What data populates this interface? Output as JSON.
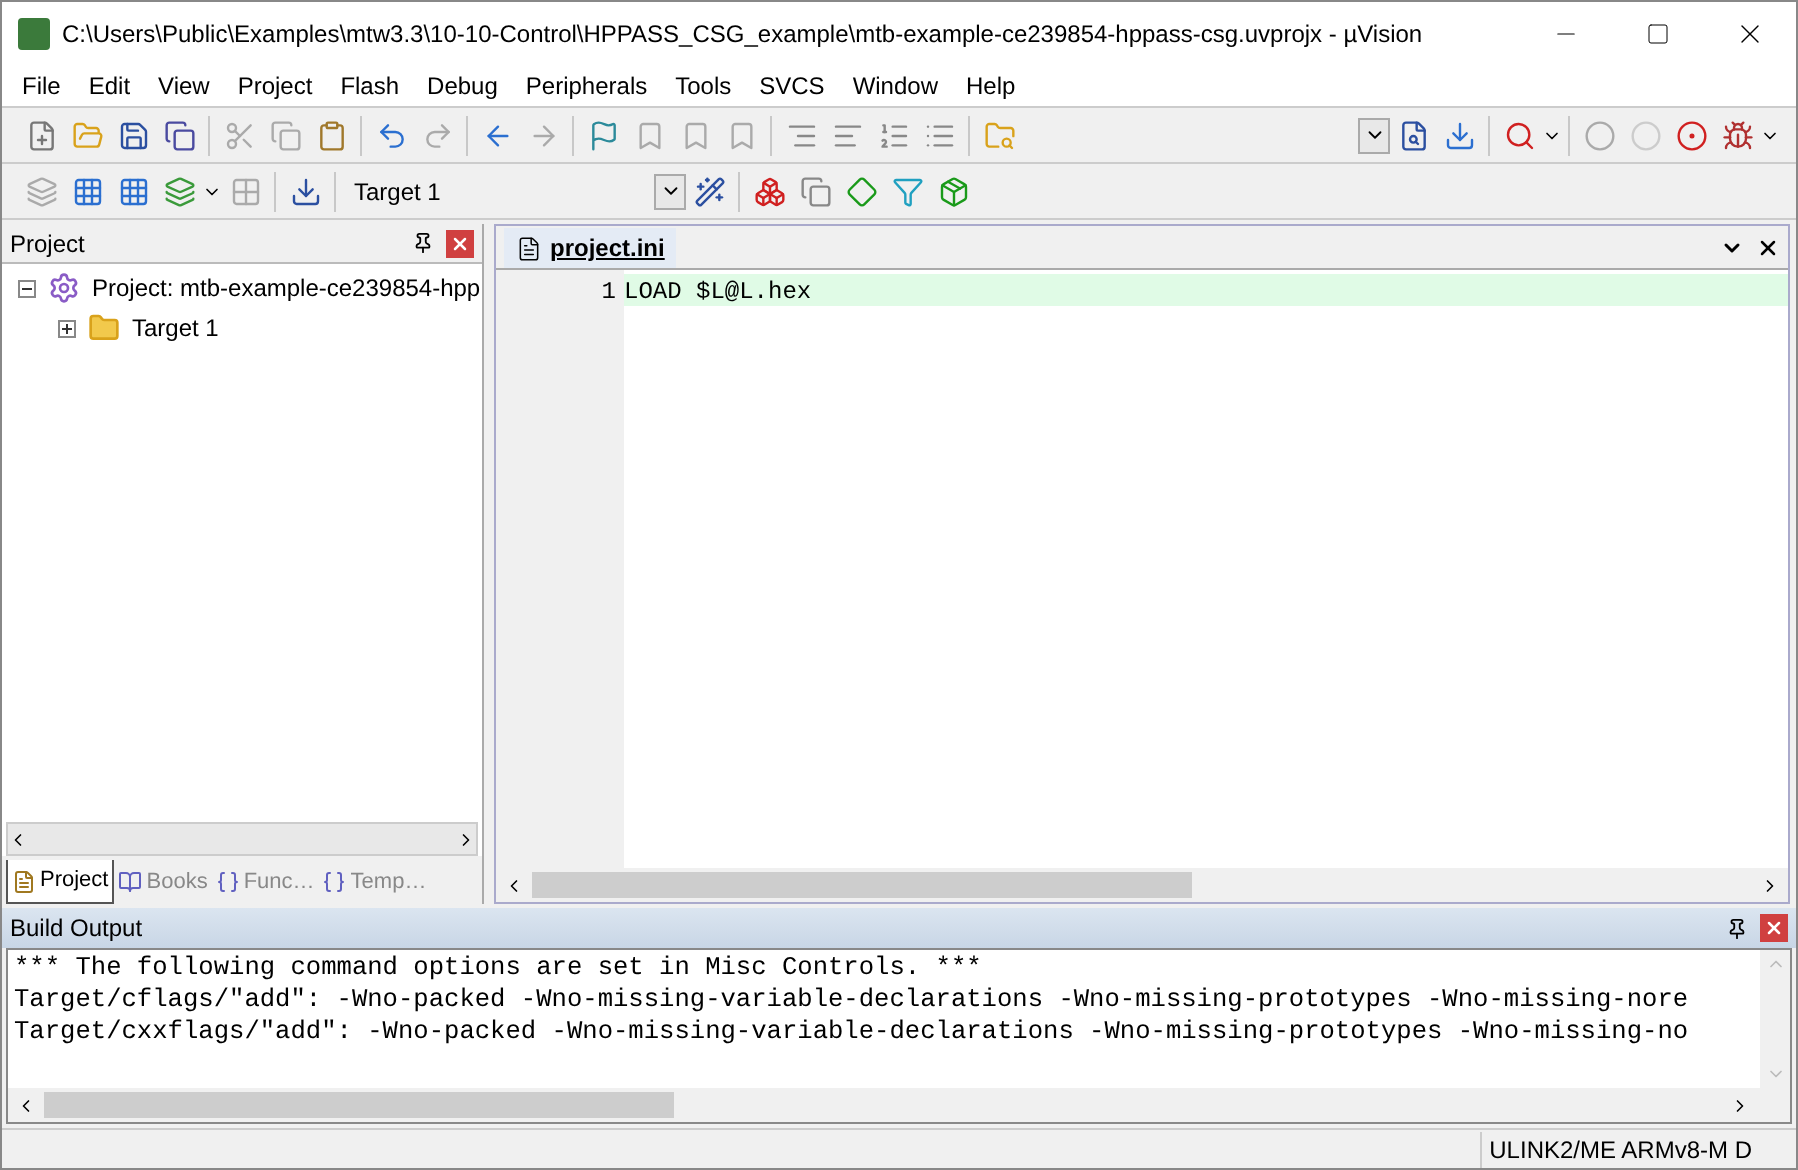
{
  "window": {
    "title": "C:\\Users\\Public\\Examples\\mtw3.3\\10-10-Control\\HPPASS_CSG_example\\mtb-example-ce239854-hppass-csg.uvprojx - µVision"
  },
  "menu": [
    "File",
    "Edit",
    "View",
    "Project",
    "Flash",
    "Debug",
    "Peripherals",
    "Tools",
    "SVCS",
    "Window",
    "Help"
  ],
  "toolbar": {
    "target": "Target 1"
  },
  "project_panel": {
    "title": "Project",
    "tree": [
      {
        "label": "Project: mtb-example-ce239854-hpp",
        "expanded": true,
        "children": [
          {
            "label": "Target 1",
            "expanded": false
          }
        ]
      }
    ],
    "tabs": [
      {
        "label": "Project",
        "selected": true
      },
      {
        "label": "Books",
        "selected": false
      },
      {
        "label": "Func…",
        "selected": false
      },
      {
        "label": "Temp…",
        "selected": false
      }
    ]
  },
  "editor": {
    "tabs": [
      {
        "label": "project.ini",
        "selected": true
      }
    ],
    "lines": [
      {
        "number": "1",
        "text": "LOAD $L@L.hex"
      }
    ]
  },
  "build_output": {
    "title": "Build Output",
    "lines": [
      "*** The following command options are set in Misc Controls. ***",
      "Target/cflags/\"add\": -Wno-packed -Wno-missing-variable-declarations -Wno-missing-prototypes -Wno-missing-nore",
      "Target/cxxflags/\"add\": -Wno-packed -Wno-missing-variable-declarations -Wno-missing-prototypes -Wno-missing-no"
    ]
  },
  "status_bar": {
    "target": "ULINK2/ME ARMv8-M D"
  }
}
